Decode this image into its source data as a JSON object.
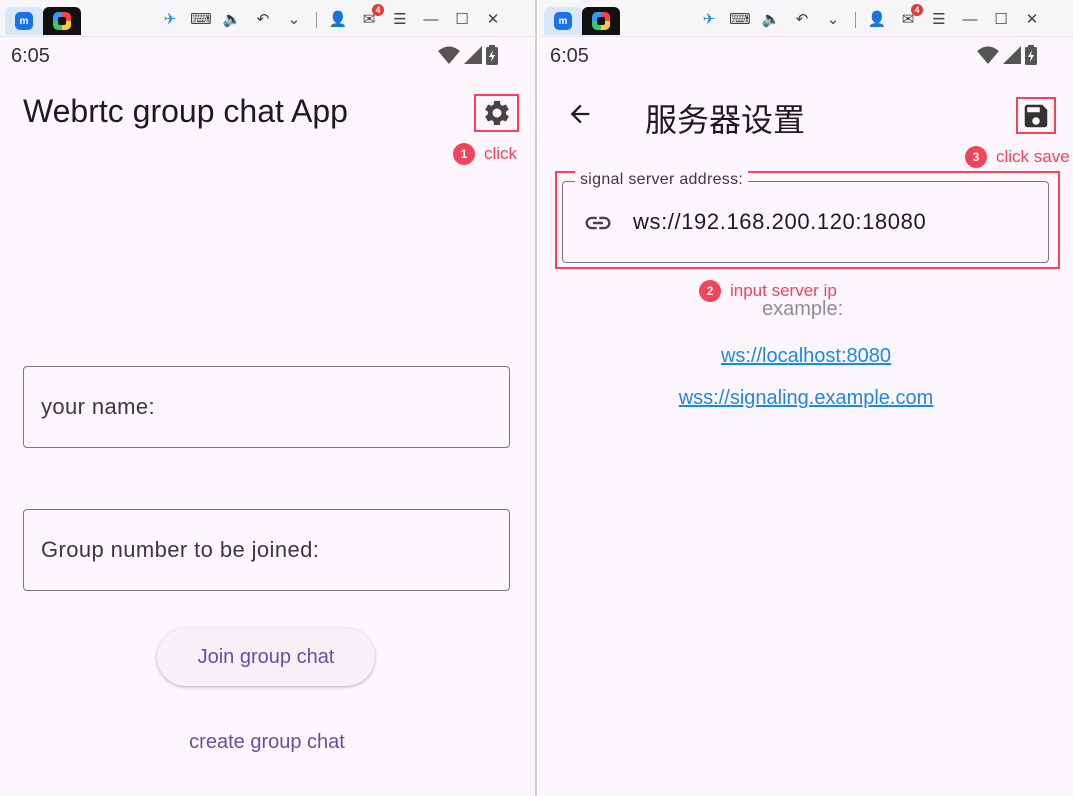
{
  "left": {
    "status_time": "6:05",
    "app_title": "Webrtc group chat App",
    "name_field_label": "your name:",
    "group_field_label": "Group number to be joined:",
    "join_button": "Join group chat",
    "create_link": "create group chat",
    "annotation": {
      "number": "1",
      "text": "click"
    }
  },
  "right": {
    "status_time": "6:05",
    "page_title": "服务器设置",
    "server_field_label": "signal server address:",
    "server_field_value": "ws://192.168.200.120:18080",
    "example_label": "example:",
    "example_links": [
      "ws://localhost:8080",
      "wss://signaling.example.com"
    ],
    "annotation_input": {
      "number": "2",
      "text": "input server ip"
    },
    "annotation_save": {
      "number": "3",
      "text": "click save"
    }
  },
  "window_bar": {
    "mail_badge": "4"
  },
  "colors": {
    "annotation": "#f2445b",
    "primary": "#6750a4",
    "link": "#1e88e5",
    "background": "#fdf7fd"
  },
  "icons": [
    "settings-gear-icon",
    "back-arrow-icon",
    "save-icon",
    "link-icon",
    "wifi-icon",
    "signal-icon",
    "battery-icon"
  ]
}
